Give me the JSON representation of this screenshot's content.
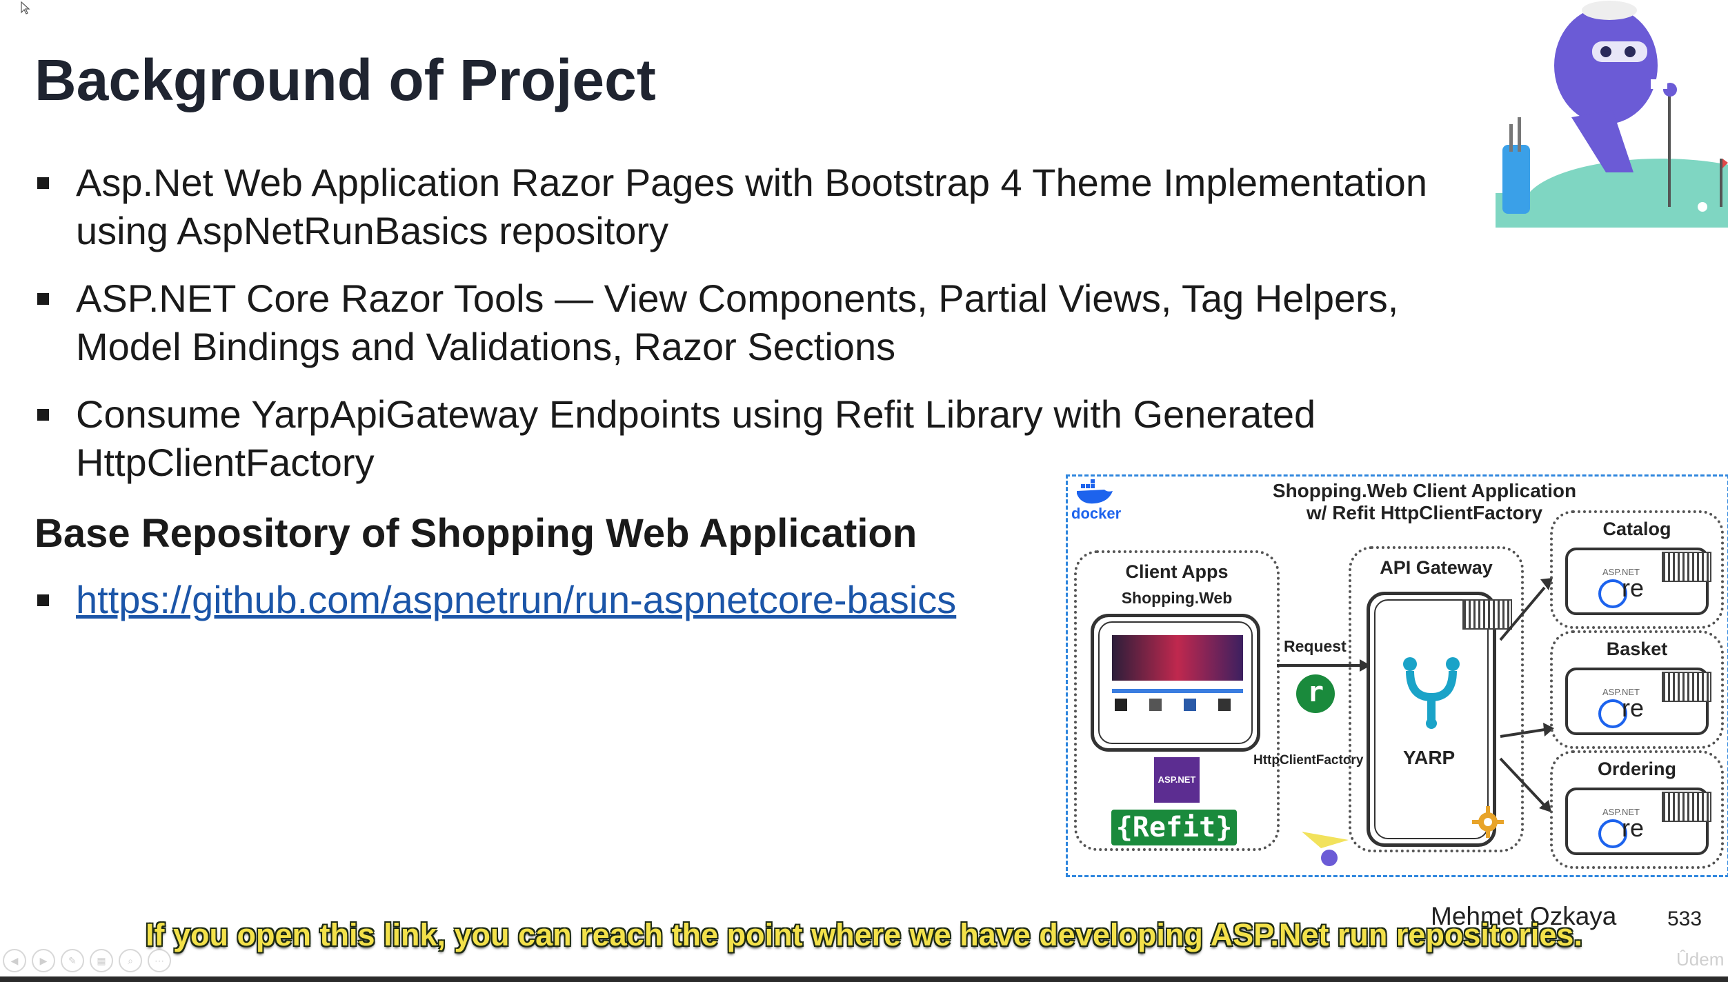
{
  "slide": {
    "title": "Background of Project",
    "bullets": [
      {
        "line1": "Asp.Net Web Application Razor Pages with Bootstrap 4 Theme Implementation",
        "line2": "using AspNetRunBasics repository"
      },
      {
        "line1": "ASP.NET Core Razor Tools — View Components, Partial Views, Tag Helpers,",
        "line2": "Model Bindings and Validations, Razor Sections"
      },
      {
        "line1": "Consume YarpApiGateway Endpoints using Refit Library with Generated",
        "line2": "HttpClientFactory"
      }
    ],
    "subheading": "Base Repository of Shopping Web Application",
    "link": "https://github.com/aspnetrun/run-aspnetcore-basics"
  },
  "diagram": {
    "title_line1": "Shopping.Web Client Application",
    "title_line2": "w/ Refit HttpClientFactory",
    "docker": "docker",
    "client_apps": "Client Apps",
    "shopping_web": "Shopping.Web",
    "aspnet_badge": "ASP.NET",
    "refit": "{Refit}",
    "request": "Request",
    "http_client_factory": "HttpClientFactory",
    "refit_logo": "r",
    "api_gateway": "API Gateway",
    "yarp": "YARP",
    "services": [
      {
        "name": "Catalog",
        "small": "ASP.NET",
        "core": "re"
      },
      {
        "name": "Basket",
        "small": "ASP.NET",
        "core": "re"
      },
      {
        "name": "Ordering",
        "small": "ASP.NET",
        "core": "re"
      }
    ]
  },
  "footer": {
    "author": "Mehmet Ozkaya",
    "page": "533",
    "caption": "If you open this link, you can reach the point where we have developing ASP.Net run repositories.",
    "watermark": "Ûdem"
  }
}
